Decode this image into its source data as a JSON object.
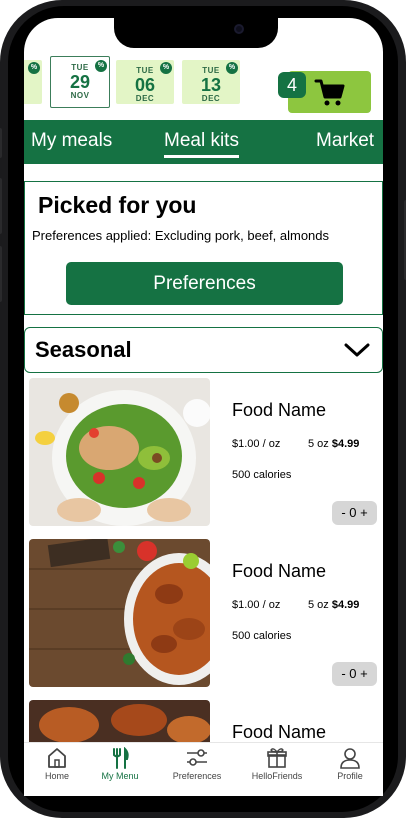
{
  "dates": [
    {
      "dow": "",
      "day": "",
      "mon": "",
      "badge": "%",
      "partial": true
    },
    {
      "dow": "TUE",
      "day": "29",
      "mon": "NOV",
      "badge": "%",
      "selected": true
    },
    {
      "dow": "TUE",
      "day": "06",
      "mon": "DEC",
      "badge": "%"
    },
    {
      "dow": "TUE",
      "day": "13",
      "mon": "DEC",
      "badge": "%"
    }
  ],
  "cart": {
    "count": "4",
    "icon": "cart-icon"
  },
  "tabs": [
    {
      "label": "My meals"
    },
    {
      "label": "Meal kits",
      "active": true
    },
    {
      "label": "Market"
    }
  ],
  "picked": {
    "title": "Picked for you",
    "subtitle": "Preferences applied: Excluding pork, beef, almonds",
    "button": "Preferences"
  },
  "seasonal": {
    "label": "Seasonal",
    "icon": "chevron-down-icon"
  },
  "foods": [
    {
      "name": "Food Name",
      "price": "$1.00 / oz",
      "weight": "5 oz",
      "total": "$4.99",
      "calories": "500 calories",
      "stepper": "- 0 +"
    },
    {
      "name": "Food Name",
      "price": "$1.00 / oz",
      "weight": "5 oz",
      "total": "$4.99",
      "calories": "500 calories",
      "stepper": "- 0 +"
    },
    {
      "name": "Food Name"
    }
  ],
  "bottom_nav": [
    {
      "label": "Home",
      "icon": "home-icon"
    },
    {
      "label": "My Menu",
      "icon": "fork-knife-icon",
      "active": true
    },
    {
      "label": "Preferences",
      "icon": "sliders-icon"
    },
    {
      "label": "HelloFriends",
      "icon": "gift-icon"
    },
    {
      "label": "Profile",
      "icon": "profile-icon"
    }
  ],
  "colors": {
    "brand_green": "#157243",
    "light_green": "#8dc63f",
    "date_bg": "#e3f5c6"
  }
}
